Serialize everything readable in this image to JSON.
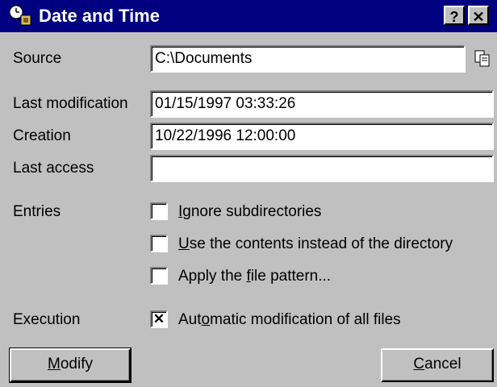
{
  "window": {
    "title": "Date and Time",
    "help_label": "?",
    "close_label": "✕"
  },
  "source": {
    "label": "Source",
    "value": "C:\\Documents"
  },
  "last_modification": {
    "label": "Last modification",
    "value": "01/15/1997 03:33:26"
  },
  "creation": {
    "label": "Creation",
    "value": "10/22/1996 12:00:00"
  },
  "last_access": {
    "label": "Last access",
    "value": ""
  },
  "entries": {
    "label": "Entries",
    "options": [
      {
        "pre": "",
        "key": "I",
        "post": "gnore subdirectories",
        "checked": false
      },
      {
        "pre": "",
        "key": "U",
        "post": "se the contents instead of the directory",
        "checked": false
      },
      {
        "pre": "Apply the ",
        "key": "f",
        "post": "ile pattern...",
        "checked": false
      }
    ]
  },
  "execution": {
    "label": "Execution",
    "option": {
      "pre": "Aut",
      "key": "o",
      "post": "matic modification of all files",
      "checked": true,
      "mark": "✕"
    }
  },
  "buttons": {
    "modify": {
      "key": "M",
      "rest": "odify"
    },
    "cancel": {
      "key": "C",
      "rest": "ancel"
    }
  },
  "colors": {
    "titlebar": "#000080",
    "face": "#c0c0c0"
  }
}
